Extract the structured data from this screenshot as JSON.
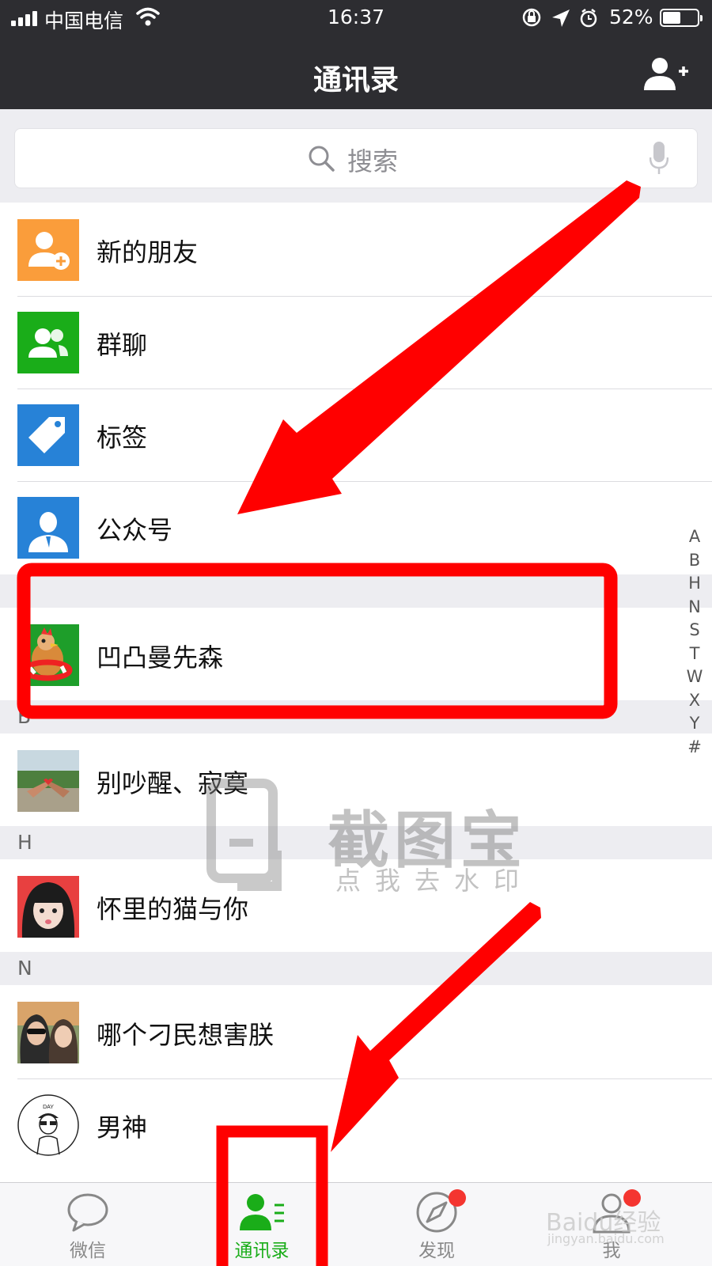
{
  "status_bar": {
    "carrier": "中国电信",
    "time": "16:37",
    "battery_percent": "52%",
    "battery_level": 0.52
  },
  "nav": {
    "title": "通讯录",
    "add_contact_icon": "add-contact-icon"
  },
  "search": {
    "placeholder": "搜索"
  },
  "functions": [
    {
      "label": "新的朋友",
      "icon": "new-friend-icon",
      "color": "#fa9d3b"
    },
    {
      "label": "群聊",
      "icon": "group-chat-icon",
      "color": "#1aad19"
    },
    {
      "label": "标签",
      "icon": "tag-icon",
      "color": "#2782d7"
    },
    {
      "label": "公众号",
      "icon": "official-account-icon",
      "color": "#2782d7"
    }
  ],
  "sections": [
    {
      "letter": "",
      "contacts": [
        {
          "name": "凹凸曼先森"
        }
      ]
    },
    {
      "letter": "B",
      "contacts": [
        {
          "name": "别吵醒、寂寞"
        }
      ]
    },
    {
      "letter": "H",
      "contacts": [
        {
          "name": "怀里的猫与你"
        }
      ]
    },
    {
      "letter": "N",
      "contacts": [
        {
          "name": "哪个刁民想害朕"
        },
        {
          "name": "男神"
        }
      ]
    }
  ],
  "index_letters": [
    "A",
    "B",
    "H",
    "N",
    "S",
    "T",
    "W",
    "X",
    "Y",
    "#"
  ],
  "tabs": [
    {
      "label": "微信",
      "icon": "chat-icon",
      "active": false,
      "badge": false
    },
    {
      "label": "通讯录",
      "icon": "contacts-icon",
      "active": true,
      "badge": false
    },
    {
      "label": "发现",
      "icon": "compass-icon",
      "active": false,
      "badge": true
    },
    {
      "label": "我",
      "icon": "profile-icon",
      "active": false,
      "badge": true
    }
  ],
  "watermark": {
    "title": "截图宝",
    "subtitle": "点我去水印"
  },
  "baidu_watermark": {
    "title": "Baidu经验",
    "url": "jingyan.baidu.com"
  },
  "colors": {
    "nav_bg": "#2d2d31",
    "accent_green": "#1aad19",
    "annotation_red": "#ff0000",
    "badge_red": "#f43530"
  }
}
